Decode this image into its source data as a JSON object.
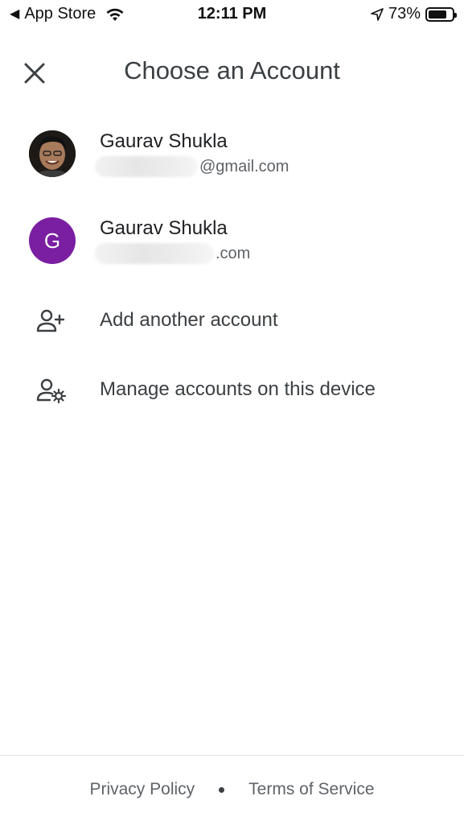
{
  "status_bar": {
    "back_label": "App Store",
    "time": "12:11 PM",
    "battery": "73%"
  },
  "header": {
    "title": "Choose an Account"
  },
  "accounts": [
    {
      "name": "Gaurav Shukla",
      "email_suffix": "@gmail.com",
      "avatar_type": "photo"
    },
    {
      "name": "Gaurav Shukla",
      "email_suffix": ".com",
      "avatar_letter": "G",
      "avatar_color": "#7b1fa2"
    }
  ],
  "actions": [
    {
      "label": "Add another account",
      "icon": "person-add-icon"
    },
    {
      "label": "Manage accounts on this device",
      "icon": "manage-accounts-icon"
    }
  ],
  "footer": {
    "privacy": "Privacy Policy",
    "terms": "Terms of Service"
  }
}
